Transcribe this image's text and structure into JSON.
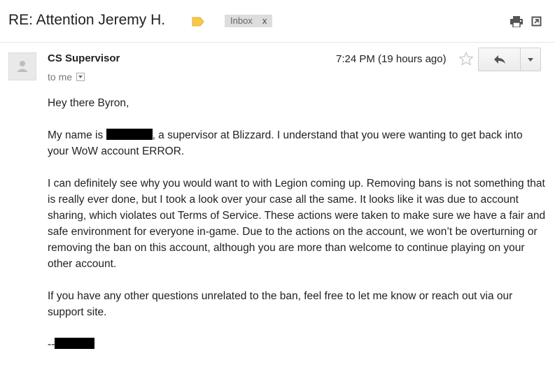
{
  "header": {
    "subject": "RE: Attention Jeremy H.",
    "label_chip": "Inbox",
    "label_chip_close": "x",
    "icons": [
      "label-tag-icon",
      "print-icon",
      "popout-icon"
    ],
    "label_color": "#f8c84a"
  },
  "message": {
    "sender": "CS Supervisor",
    "recipient": "to me",
    "timestamp": "7:24 PM (19 hours ago)",
    "icons": [
      "avatar-icon",
      "star-icon",
      "reply-icon",
      "more-caret-icon"
    ]
  },
  "body": {
    "greeting": "Hey there Byron,",
    "p1_before": "My name is ",
    "p1_after": ", a supervisor at Blizzard. I understand that you were wanting to get back into your WoW account ERROR.",
    "p2": "I can definitely see why you would want to with Legion coming up. Removing bans is not something that is really ever done, but I took a look over your case all the same. It looks like it was due to account sharing, which violates out Terms of Service. These actions were taken to make sure we have a fair and safe environment for everyone in-game. Due to the actions on the account, we won’t be overturning or removing the ban on this account, although you are more than welcome to continue playing on your other account.",
    "p3": "If you have any other questions unrelated to the ban, feel free to let me know or reach out via our support site.",
    "signoff": "--"
  }
}
